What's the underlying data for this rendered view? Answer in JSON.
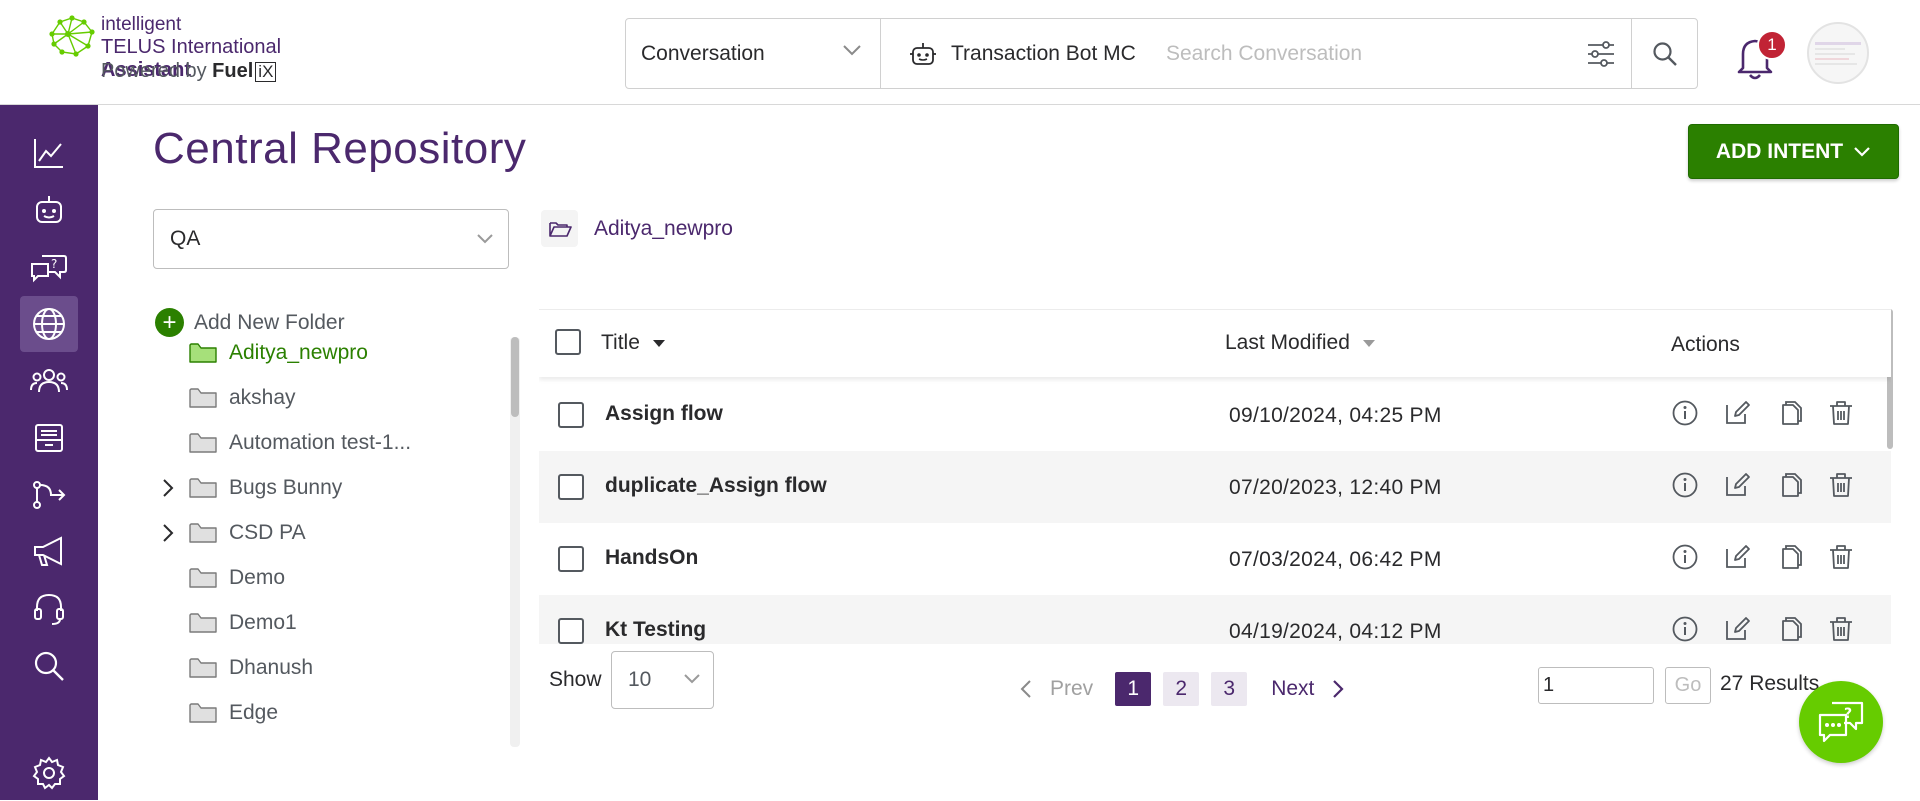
{
  "header": {
    "logo": {
      "line1": "intelligent",
      "line2_prefix": "TELUS International ",
      "line2_bold": "Assistant",
      "line3_prefix": "Powered by ",
      "line3_fuel": "Fuel",
      "line3_ix": "iX"
    },
    "search": {
      "type_value": "Conversation",
      "bot_name": "Transaction Bot MC",
      "placeholder": "Search Conversation"
    },
    "notifications_count": "1"
  },
  "page": {
    "title": "Central Repository",
    "add_intent_label": "ADD INTENT"
  },
  "repo_select": {
    "value": "QA"
  },
  "folders": {
    "add_label": "Add New Folder",
    "items": [
      {
        "name": "Aditya_newpro",
        "expandable": false,
        "active": true
      },
      {
        "name": "akshay",
        "expandable": false,
        "active": false
      },
      {
        "name": "Automation test-1...",
        "expandable": false,
        "active": false
      },
      {
        "name": "Bugs Bunny",
        "expandable": true,
        "active": false
      },
      {
        "name": "CSD PA",
        "expandable": true,
        "active": false
      },
      {
        "name": "Demo",
        "expandable": false,
        "active": false
      },
      {
        "name": "Demo1",
        "expandable": false,
        "active": false
      },
      {
        "name": "Dhanush",
        "expandable": false,
        "active": false
      },
      {
        "name": "Edge",
        "expandable": false,
        "active": false
      }
    ]
  },
  "breadcrumb": {
    "current": "Aditya_newpro"
  },
  "table": {
    "columns": {
      "title": "Title",
      "modified": "Last Modified",
      "actions": "Actions"
    },
    "rows": [
      {
        "title": "Assign flow",
        "modified": "09/10/2024, 04:25 PM"
      },
      {
        "title": "duplicate_Assign flow",
        "modified": "07/20/2023, 12:40 PM"
      },
      {
        "title": "HandsOn",
        "modified": "07/03/2024, 06:42 PM"
      },
      {
        "title": "Kt Testing",
        "modified": "04/19/2024, 04:12 PM"
      }
    ]
  },
  "pagination": {
    "show_label": "Show",
    "page_size": "10",
    "prev_label": "Prev",
    "pages": [
      "1",
      "2",
      "3"
    ],
    "current_page": "1",
    "next_label": "Next",
    "goto_value": "1",
    "go_label": "Go",
    "results": "27 Results"
  },
  "colors": {
    "brand_purple": "#4b286d",
    "brand_green": "#2b8000",
    "help_green": "#66cc00",
    "badge_red": "#c12335"
  }
}
